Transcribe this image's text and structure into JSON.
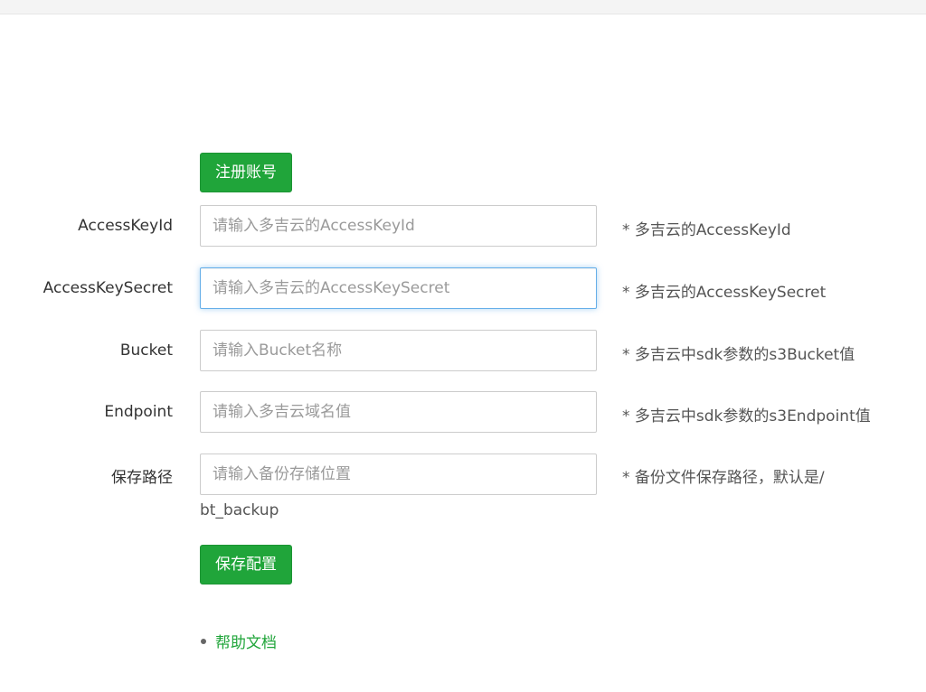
{
  "register_button": "注册账号",
  "fields": [
    {
      "label": "AccessKeyId",
      "placeholder": "请输入多吉云的AccessKeyId",
      "value": "",
      "hint": "* 多吉云的AccessKeyId"
    },
    {
      "label": "AccessKeySecret",
      "placeholder": "请输入多吉云的AccessKeySecret",
      "value": "",
      "hint": "* 多吉云的AccessKeySecret"
    },
    {
      "label": "Bucket",
      "placeholder": "请输入Bucket名称",
      "value": "",
      "hint": "* 多吉云中sdk参数的s3Bucket值"
    },
    {
      "label": "Endpoint",
      "placeholder": "请输入多吉云域名值",
      "value": "",
      "hint": "* 多吉云中sdk参数的s3Endpoint值"
    },
    {
      "label": "保存路径",
      "placeholder": "请输入备份存储位置",
      "value": "",
      "hint": "* 备份文件保存路径，默认是/"
    }
  ],
  "path_default": "bt_backup",
  "save_button": "保存配置",
  "help_link": "帮助文档",
  "colors": {
    "primary_green": "#20a53a",
    "focus_blue": "#66afe9"
  }
}
